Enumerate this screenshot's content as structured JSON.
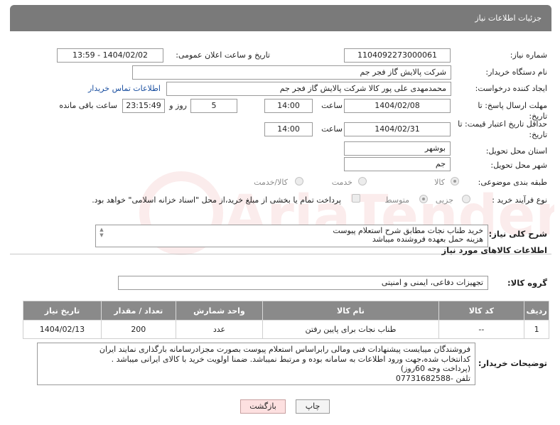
{
  "header": {
    "title": "جزئیات اطلاعات نیاز"
  },
  "need_number": {
    "label": "شماره نیاز:",
    "value": "1104092273000061"
  },
  "announce_datetime": {
    "label": "تاریخ و ساعت اعلان عمومی:",
    "value": "1404/02/02 - 13:59"
  },
  "buyer_org": {
    "label": "نام دستگاه خریدار:",
    "value": "شرکت پالایش گاز فجر جم"
  },
  "requester": {
    "label": "ایجاد کننده درخواست:",
    "value": "محمدمهدی علی پور کالا شرکت پالایش گاز فجر جم",
    "contact_link": "اطلاعات تماس خریدار"
  },
  "deadline": {
    "label": "مهلت ارسال پاسخ: تا تاریخ:",
    "date": "1404/02/08",
    "time_label": "ساعت",
    "time": "14:00",
    "days": "5",
    "days_label": "روز و",
    "remaining": "23:15:49",
    "remaining_label": "ساعت باقی مانده"
  },
  "price_validity": {
    "label": "حداقل تاریخ اعتبار قیمت: تا تاریخ:",
    "date": "1404/02/31",
    "time_label": "ساعت",
    "time": "14:00"
  },
  "province": {
    "label": "استان محل تحویل:",
    "value": "بوشهر"
  },
  "city": {
    "label": "شهر محل تحویل:",
    "value": "جم"
  },
  "category": {
    "label": "طبقه بندی موضوعی:",
    "options": [
      "کالا",
      "خدمت",
      "کالا/خدمت"
    ],
    "selected": "کالا"
  },
  "purchase_type": {
    "label": "نوع فرآیند خرید :",
    "options": [
      "جزیی",
      "متوسط"
    ],
    "selected": "متوسط",
    "payment_note": "پرداخت تمام یا بخشی از مبلغ خرید،از محل \"اسناد خزانه اسلامی\" خواهد بود."
  },
  "description": {
    "label": "شرح کلی نیاز:",
    "line1": "خرید طناب نجات مطابق شرح استعلام پیوست",
    "line2": "هزینه حمل بعهده فروشنده میباشد"
  },
  "goods_info": {
    "title": "اطلاعات کالاهای مورد نیاز"
  },
  "goods_group": {
    "label": "گروه کالا:",
    "value": "تجهیزات دفاعی، ایمنی و امنیتی"
  },
  "table": {
    "headers": [
      "ردیف",
      "کد کالا",
      "نام کالا",
      "واحد شمارش",
      "تعداد / مقدار",
      "تاریخ نیاز"
    ],
    "rows": [
      [
        "1",
        "--",
        "طناب نجات برای پایین رفتن",
        "عدد",
        "200",
        "1404/02/13"
      ]
    ]
  },
  "buyer_notes": {
    "label": "توضیحات خریدار:",
    "lines": [
      "فروشندگان میبایست پیشنهادات فنی ومالی رابراساس استعلام پیوست بصورت مجزادرسامانه بارگذاری نمایند ایران",
      "کدانتخاب شده،جهت ورود اطلاعات به سامانه بوده و مرتبط نمیباشد. ضمنا اولویت خرید با کالای ایرانی میباشد .",
      "(پرداخت وجه 60روز)",
      "تلفن -07731682588"
    ]
  },
  "buttons": {
    "print": "چاپ",
    "back": "بازگشت"
  },
  "watermark": {
    "text": "AriaTender.neT"
  }
}
